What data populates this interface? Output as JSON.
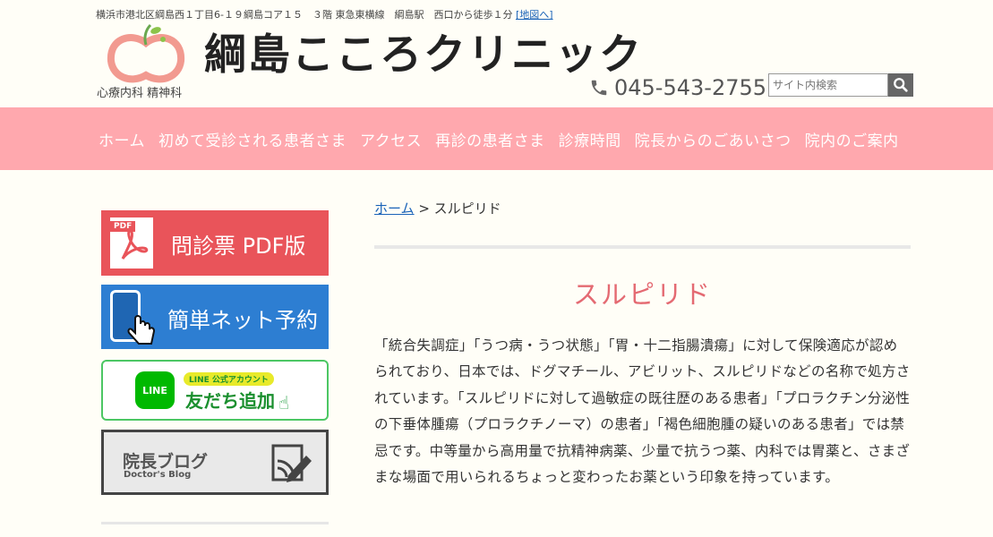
{
  "header": {
    "address": "横浜市港北区綱島西１丁目6-１９綱島コア１５　３階 東急東横線　綱島駅　西口から徒歩１分",
    "map_link": "[地図へ]",
    "logo_subtitle": "心療内科 精神科",
    "clinic_name": "綱島こころクリニック",
    "phone": "045-543-2755",
    "search": {
      "placeholder": "サイト内検索"
    }
  },
  "nav": {
    "items": [
      {
        "label": "ホーム"
      },
      {
        "label": "初めて受診される患者さま"
      },
      {
        "label": "アクセス"
      },
      {
        "label": "再診の患者さま"
      },
      {
        "label": "診療時間"
      },
      {
        "label": "院長からのごあいさつ"
      },
      {
        "label": "院内のご案内"
      }
    ]
  },
  "sidebar": {
    "pdf_banner": {
      "tag": "PDF",
      "label": "問診票 PDF版"
    },
    "net_banner": {
      "label": "簡単ネット予約"
    },
    "line_banner": {
      "icon_text": "LINE",
      "pill": "LINE 公式アカウント",
      "label": "友だち追加"
    },
    "blog_banner": {
      "label": "院長ブログ",
      "sublabel": "Doctor's Blog"
    }
  },
  "breadcrumb": {
    "home": "ホーム",
    "separator": " > ",
    "current": "スルピリド"
  },
  "main": {
    "title": "スルピリド",
    "body": "「統合失調症」「うつ病・うつ状態」「胃・十二指腸潰瘍」に対して保険適応が認められており、日本では、ドグマチール、アビリット、スルピリドなどの名称で処方されています。「スルピリドに対して過敏症の既往歴のある患者」「プロラクチン分泌性の下垂体腫瘍（プロラクチノーマ）の患者」「褐色細胞腫の疑いのある患者」では禁忌です。中等量から高用量で抗精神病薬、少量で抗うつ薬、内科では胃薬と、さまざまな場面で用いられるちょっと変わったお薬という印象を持っています。"
  },
  "colors": {
    "nav_bg": "#ffa8ae",
    "title_pink": "#e46a72",
    "pdf_red": "#e9545a",
    "net_blue": "#2d7ed2",
    "line_green": "#00b900"
  }
}
